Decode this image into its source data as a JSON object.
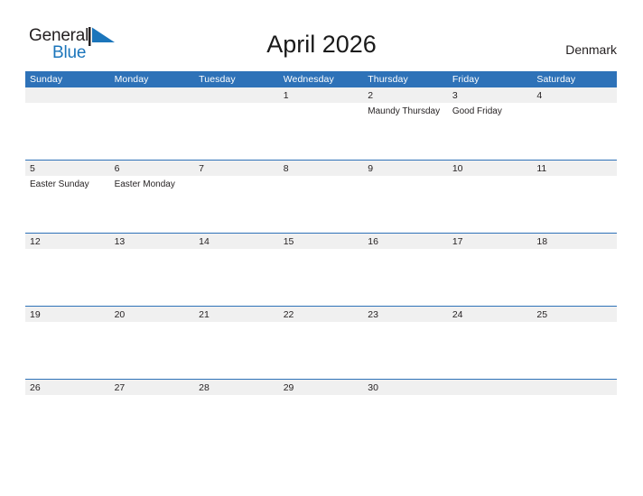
{
  "brand": {
    "name_part1": "General",
    "name_part2": "Blue",
    "flag_icon": "blue-flag-triangle-icon",
    "color_primary": "#1b75bb",
    "color_text": "#231f20"
  },
  "header": {
    "title": "April 2026",
    "country": "Denmark"
  },
  "calendar": {
    "accent_color": "#2e72b8",
    "date_band_color": "#f0f0f0",
    "weekdays": [
      "Sunday",
      "Monday",
      "Tuesday",
      "Wednesday",
      "Thursday",
      "Friday",
      "Saturday"
    ],
    "weeks": [
      {
        "days": [
          {
            "date": "",
            "events": []
          },
          {
            "date": "",
            "events": []
          },
          {
            "date": "",
            "events": []
          },
          {
            "date": "1",
            "events": []
          },
          {
            "date": "2",
            "events": [
              "Maundy Thursday"
            ]
          },
          {
            "date": "3",
            "events": [
              "Good Friday"
            ]
          },
          {
            "date": "4",
            "events": []
          }
        ]
      },
      {
        "days": [
          {
            "date": "5",
            "events": [
              "Easter Sunday"
            ]
          },
          {
            "date": "6",
            "events": [
              "Easter Monday"
            ]
          },
          {
            "date": "7",
            "events": []
          },
          {
            "date": "8",
            "events": []
          },
          {
            "date": "9",
            "events": []
          },
          {
            "date": "10",
            "events": []
          },
          {
            "date": "11",
            "events": []
          }
        ]
      },
      {
        "days": [
          {
            "date": "12",
            "events": []
          },
          {
            "date": "13",
            "events": []
          },
          {
            "date": "14",
            "events": []
          },
          {
            "date": "15",
            "events": []
          },
          {
            "date": "16",
            "events": []
          },
          {
            "date": "17",
            "events": []
          },
          {
            "date": "18",
            "events": []
          }
        ]
      },
      {
        "days": [
          {
            "date": "19",
            "events": []
          },
          {
            "date": "20",
            "events": []
          },
          {
            "date": "21",
            "events": []
          },
          {
            "date": "22",
            "events": []
          },
          {
            "date": "23",
            "events": []
          },
          {
            "date": "24",
            "events": []
          },
          {
            "date": "25",
            "events": []
          }
        ]
      },
      {
        "days": [
          {
            "date": "26",
            "events": []
          },
          {
            "date": "27",
            "events": []
          },
          {
            "date": "28",
            "events": []
          },
          {
            "date": "29",
            "events": []
          },
          {
            "date": "30",
            "events": []
          },
          {
            "date": "",
            "events": []
          },
          {
            "date": "",
            "events": []
          }
        ]
      }
    ]
  }
}
